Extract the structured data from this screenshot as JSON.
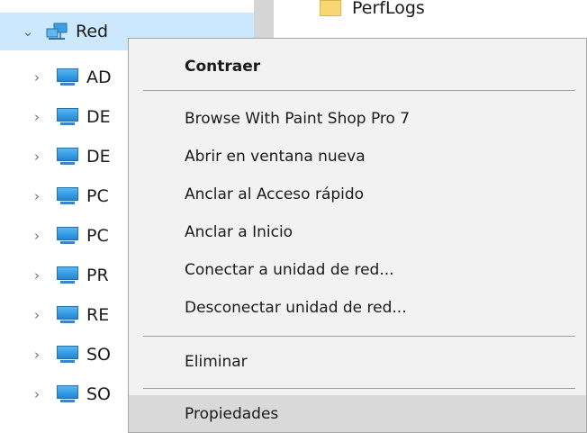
{
  "content": {
    "folder_label": "PerfLogs"
  },
  "tree": {
    "root": {
      "label": "Red",
      "expanded": true
    },
    "items": [
      {
        "label": "AD"
      },
      {
        "label": "DE"
      },
      {
        "label": "DE"
      },
      {
        "label": "PC"
      },
      {
        "label": "PC"
      },
      {
        "label": "PR"
      },
      {
        "label": "RE"
      },
      {
        "label": "SO"
      },
      {
        "label": "SO"
      }
    ]
  },
  "context_menu": {
    "items": [
      {
        "label": "Contraer",
        "bold": true
      },
      {
        "label": "Browse With Paint Shop Pro 7"
      },
      {
        "label": "Abrir en ventana nueva"
      },
      {
        "label": "Anclar al Acceso rápido"
      },
      {
        "label": "Anclar a Inicio"
      },
      {
        "label": "Conectar a unidad de red..."
      },
      {
        "label": "Desconectar unidad de red..."
      },
      {
        "label": "Eliminar"
      },
      {
        "label": "Propiedades",
        "highlighted": true
      }
    ]
  },
  "icons": {
    "expander_expanded": "chevron-down-icon",
    "expander_collapsed": "chevron-right-icon",
    "network": "network-icon",
    "computer": "computer-icon",
    "folder": "folder-icon"
  },
  "colors": {
    "selection": "#cce8ff",
    "menu_background": "#f2f2f2",
    "menu_highlight": "#d9d9d9"
  }
}
